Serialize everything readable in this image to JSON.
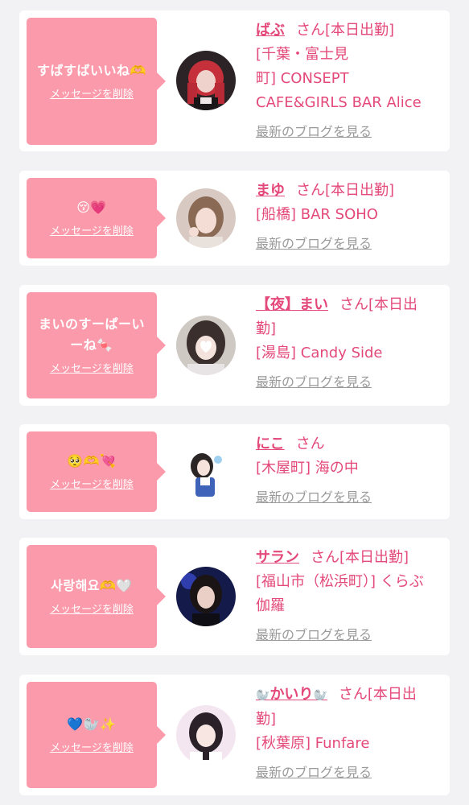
{
  "labels": {
    "delete_message": "メッセージを削除",
    "view_blog": "最新のブログを見る",
    "san": "さん",
    "on_duty": "[本日出勤]"
  },
  "colors": {
    "accent": "#e3497a",
    "bubble": "#fb9aab",
    "background": "#f2f2f4",
    "link_gray": "#9a9a9a"
  },
  "cards": [
    {
      "message_line1": "すばすばいいね🫶",
      "message_line2": "",
      "name": "ばぶ",
      "on_duty": true,
      "area_line1": "[千葉・富士見",
      "area_line2": "町] CONSEPT",
      "area_line3": "CAFE&GIRLS BAR Alice"
    },
    {
      "message_line1": "😚💗",
      "message_line2": "",
      "name": "まゆ",
      "on_duty": true,
      "area_line1": "[船橋] BAR SOHO",
      "area_line2": "",
      "area_line3": ""
    },
    {
      "message_line1": "まいのすーぱーい",
      "message_line2": "ーね🍬",
      "name": "【夜】まい",
      "on_duty": true,
      "duty_wrap_line1": "さん[本日出",
      "duty_wrap_line2": "勤]",
      "area_line1": "[湯島] Candy Side",
      "area_line2": "",
      "area_line3": ""
    },
    {
      "message_line1": "🥺🫶💘",
      "message_line2": "",
      "name": "にこ",
      "on_duty": false,
      "area_line1": "[木屋町] 海の中",
      "area_line2": "",
      "area_line3": ""
    },
    {
      "message_line1": "사랑해요🫶🤍",
      "message_line2": "",
      "name": "サラン",
      "on_duty": true,
      "area_line1": "[福山市（松浜町）] くらぶ",
      "area_line2": "伽羅",
      "area_line3": ""
    },
    {
      "message_line1": "💙🦭✨",
      "message_line2": "",
      "name": "かいり",
      "name_icon": "seal-icon",
      "on_duty": true,
      "duty_wrap_line1": "さん[本日出",
      "duty_wrap_line2": "勤]",
      "area_line1": "[秋葉原] Funfare",
      "area_line2": "",
      "area_line3": ""
    }
  ]
}
